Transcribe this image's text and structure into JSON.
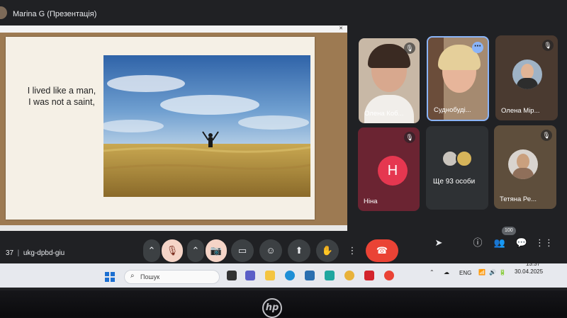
{
  "presenter": {
    "title": "Marina G (Презентація)"
  },
  "slide": {
    "line1": "I lived like a man,",
    "line2": "I was not a saint,"
  },
  "participants": [
    {
      "name": "Олена Коб...",
      "muted": true
    },
    {
      "name": "Суднобуді...",
      "muted": false
    },
    {
      "name": "Олена Мір...",
      "muted": true
    },
    {
      "name": "Ніна",
      "muted": true,
      "initial": "Н"
    },
    {
      "name": "Ще 93 особи",
      "muted": false
    },
    {
      "name": "Тетяна Ре...",
      "muted": true
    }
  ],
  "meeting": {
    "code_prefix": "37",
    "code": "ukg-dpbd-giu",
    "participant_count": "100"
  },
  "taskbar": {
    "search_placeholder": "Пошук",
    "language": "ENG",
    "time": "13:37",
    "date": "30.04.2025"
  },
  "colors": {
    "end_call": "#ea4335",
    "tile_bg": "#3c4043",
    "letter_avatar": "#e53750"
  },
  "icons": [
    "mic-off-icon",
    "camera-off-icon",
    "captions-icon",
    "emoji-icon",
    "present-icon",
    "raise-hand-icon",
    "more-icon",
    "end-call-icon",
    "info-icon",
    "people-icon",
    "chat-icon",
    "apps-icon",
    "search-icon",
    "windows-start-icon"
  ]
}
